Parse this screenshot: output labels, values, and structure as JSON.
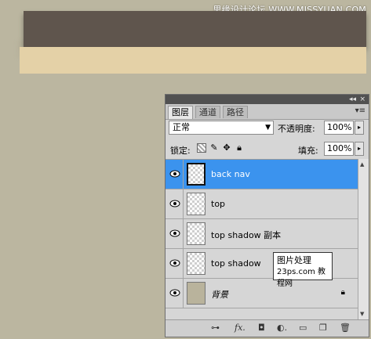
{
  "watermark_top": "思缘设计论坛 WWW.MISSYUAN.COM",
  "panel": {
    "tabs": [
      "图层",
      "通道",
      "路径"
    ],
    "blend_mode": "正常",
    "opacity_label": "不透明度:",
    "opacity_value": "100%",
    "lock_label": "锁定:",
    "fill_label": "填充:",
    "fill_value": "100%",
    "layers": [
      {
        "name": "back nav",
        "selected": true
      },
      {
        "name": "top",
        "selected": false
      },
      {
        "name": "top shadow 副本",
        "selected": false
      },
      {
        "name": "top shadow",
        "selected": false
      },
      {
        "name": "背景",
        "selected": false,
        "locked": true
      }
    ],
    "colors": {
      "selection": "#3b93ee",
      "canvas": "#bbb6a0",
      "dark_bar": "#5f554d",
      "tan_bar": "#e4d1a7"
    }
  },
  "watermark_box": {
    "line1": "图片处理",
    "line2": "23ps.com 教程网"
  }
}
